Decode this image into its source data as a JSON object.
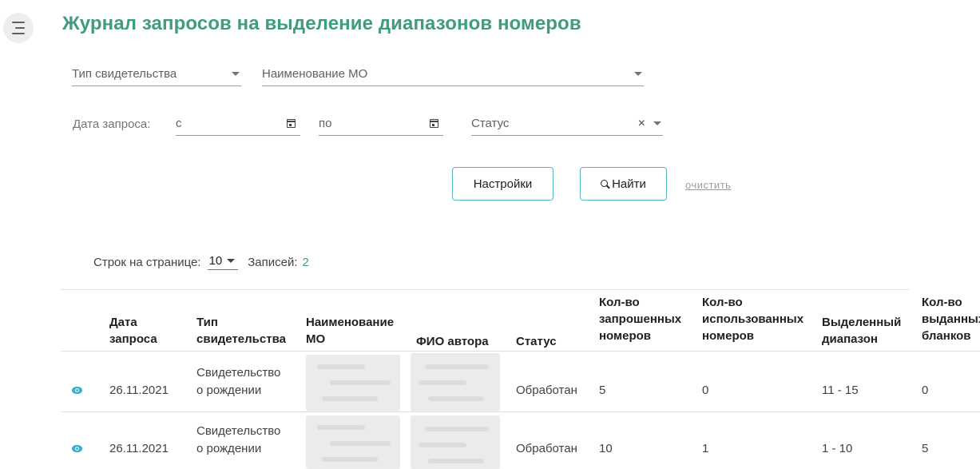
{
  "page": {
    "title": "Журнал запросов на выделение диапазонов номеров"
  },
  "filters": {
    "cert_type_label": "Тип свидетельства",
    "mo_name_label": "Наименование МО",
    "request_date_label": "Дата запроса:",
    "date_from_label": "с",
    "date_to_label": "по",
    "status_label": "Статус"
  },
  "actions": {
    "settings": "Настройки",
    "find": "Найти",
    "clear": "очистить"
  },
  "pagination": {
    "rows_per_page_label": "Строк на странице:",
    "rows_per_page": "10",
    "records_label": "Записей:",
    "records_count": "2"
  },
  "table": {
    "headers": {
      "date": [
        "Дата",
        "запроса"
      ],
      "type": [
        "Тип",
        "свидетельства"
      ],
      "mo": [
        "Наименование",
        "МО"
      ],
      "author": [
        "ФИО автора"
      ],
      "status": [
        "Статус"
      ],
      "requested": [
        "Кол-во",
        "запрошенных",
        "номеров"
      ],
      "used": [
        "Кол-во",
        "использованных",
        "номеров"
      ],
      "range": [
        "Выделенный",
        "диапазон"
      ],
      "issued": [
        "Кол-во",
        "выданных",
        "бланков"
      ]
    },
    "rows": [
      {
        "date": "26.11.2021",
        "type": [
          "Свидетельство",
          "о рождении"
        ],
        "status": "Обработан",
        "requested": "5",
        "used": "0",
        "range": "11 - 15",
        "issued": "0"
      },
      {
        "date": "26.11.2021",
        "type": [
          "Свидетельство",
          "о рождении"
        ],
        "status": "Обработан",
        "requested": "10",
        "used": "1",
        "range": "1 - 10",
        "issued": "5"
      }
    ]
  },
  "colors": {
    "accent": "#3f9b82",
    "button_border": "#55b6c5",
    "eye_icon": "#2fb1cf"
  }
}
